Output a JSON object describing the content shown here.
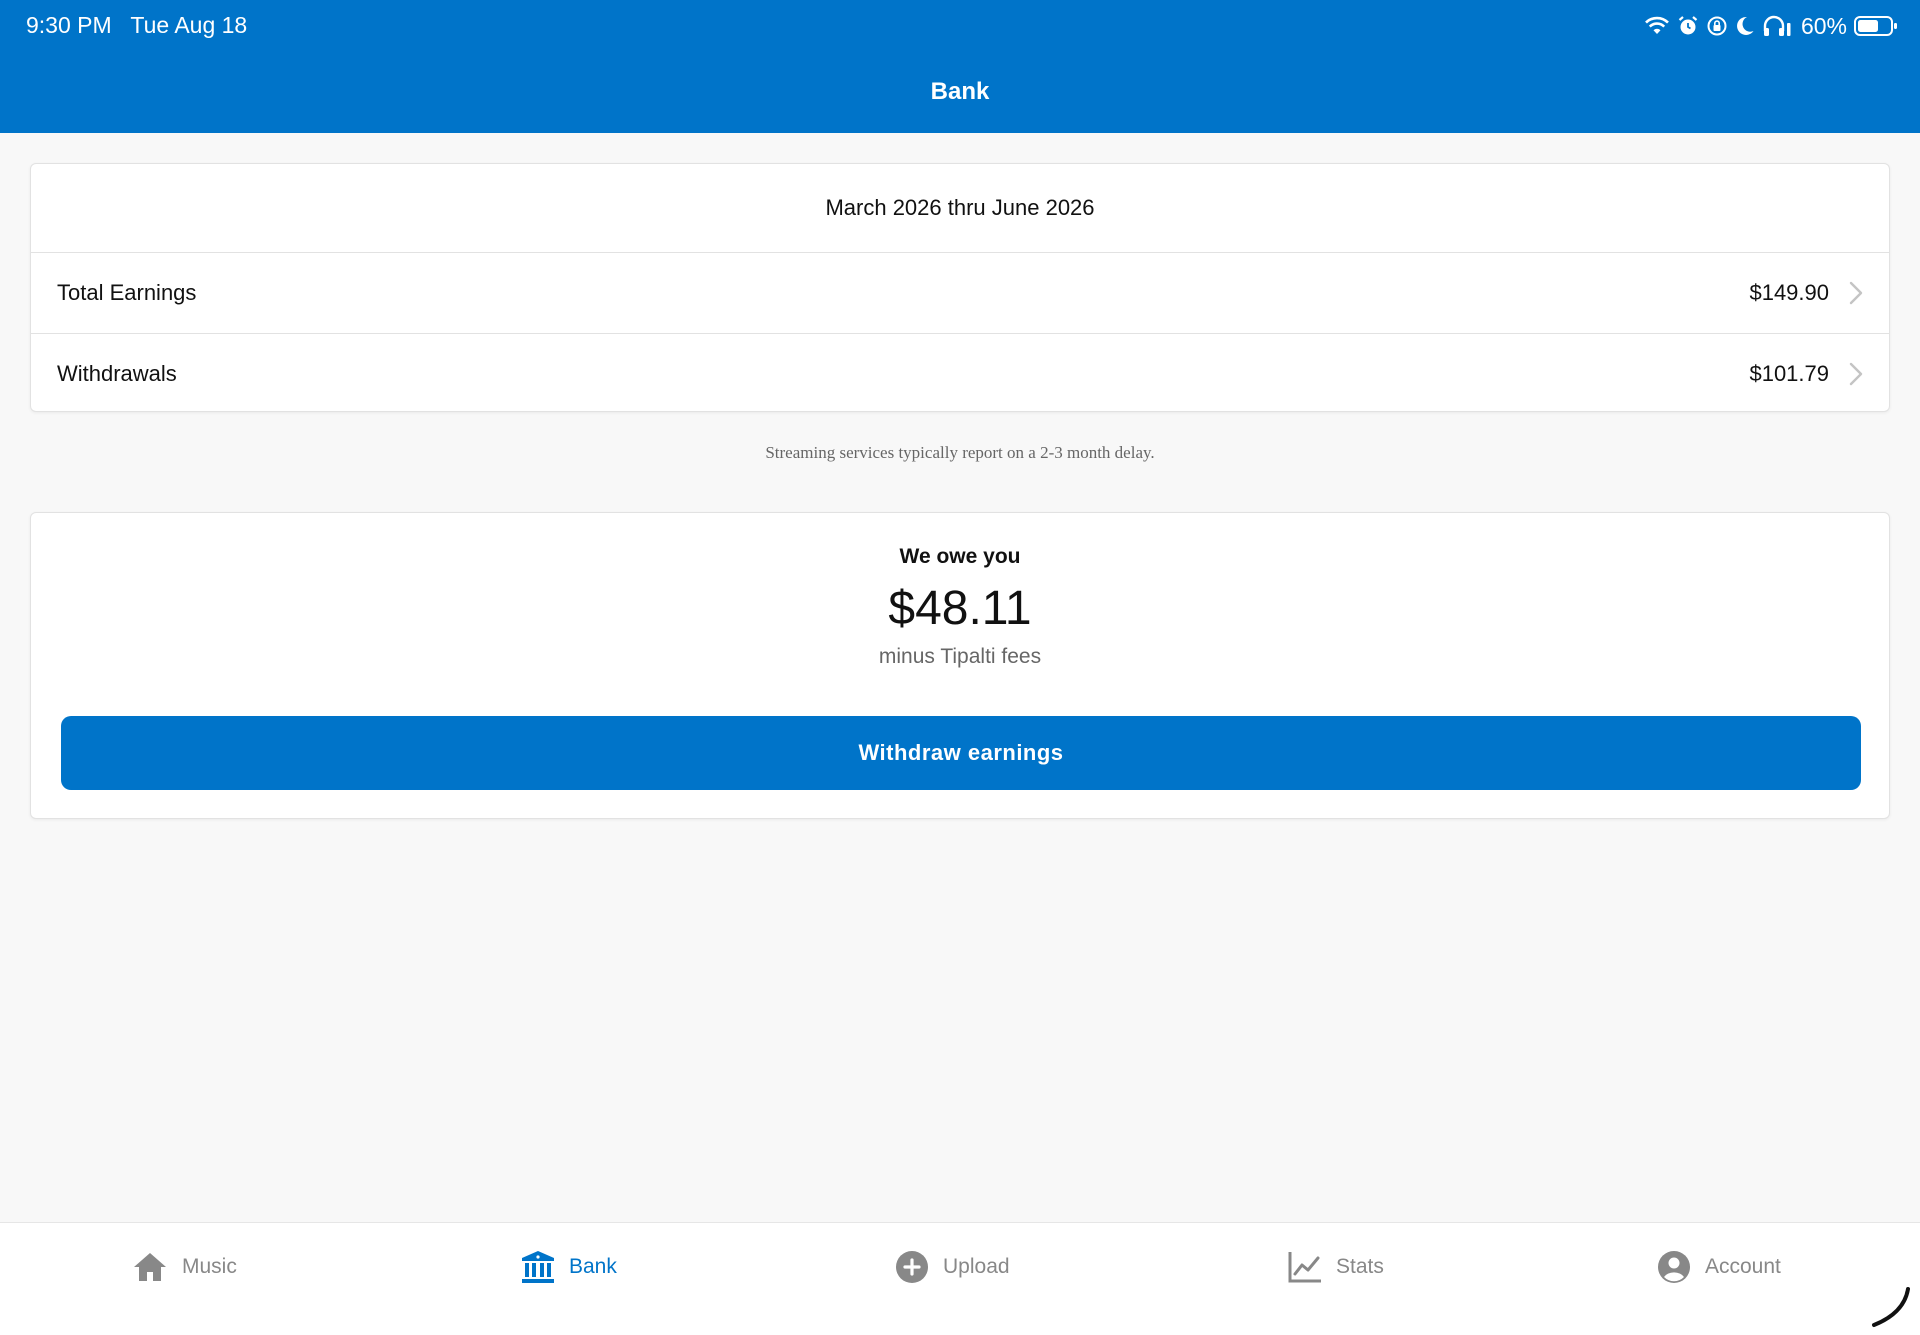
{
  "status_bar": {
    "time": "9:30 PM",
    "date": "Tue Aug 18",
    "battery_percent": "60%",
    "icons": [
      "wifi-icon",
      "alarm-icon",
      "orientation-lock-icon",
      "moon-icon",
      "headphones-icon",
      "battery-icon"
    ]
  },
  "nav": {
    "title": "Bank"
  },
  "period": {
    "label": "March 2026 thru June 2026",
    "rows": [
      {
        "label": "Total Earnings",
        "amount": "$149.90"
      },
      {
        "label": "Withdrawals",
        "amount": "$101.79"
      }
    ]
  },
  "note": "Streaming services typically report on a 2-3 month delay.",
  "owe": {
    "title": "We owe you",
    "amount": "$48.11",
    "subtitle": "minus Tipalti fees",
    "button_label": "Withdraw earnings"
  },
  "tabs": [
    {
      "label": "Music",
      "icon": "home-icon"
    },
    {
      "label": "Bank",
      "icon": "bank-icon",
      "active": true
    },
    {
      "label": "Upload",
      "icon": "plus-circle-icon"
    },
    {
      "label": "Stats",
      "icon": "chart-line-icon"
    },
    {
      "label": "Account",
      "icon": "user-circle-icon"
    }
  ],
  "colors": {
    "primary": "#0074c9",
    "background": "#f8f8f8",
    "inactive_tab": "#888888"
  }
}
